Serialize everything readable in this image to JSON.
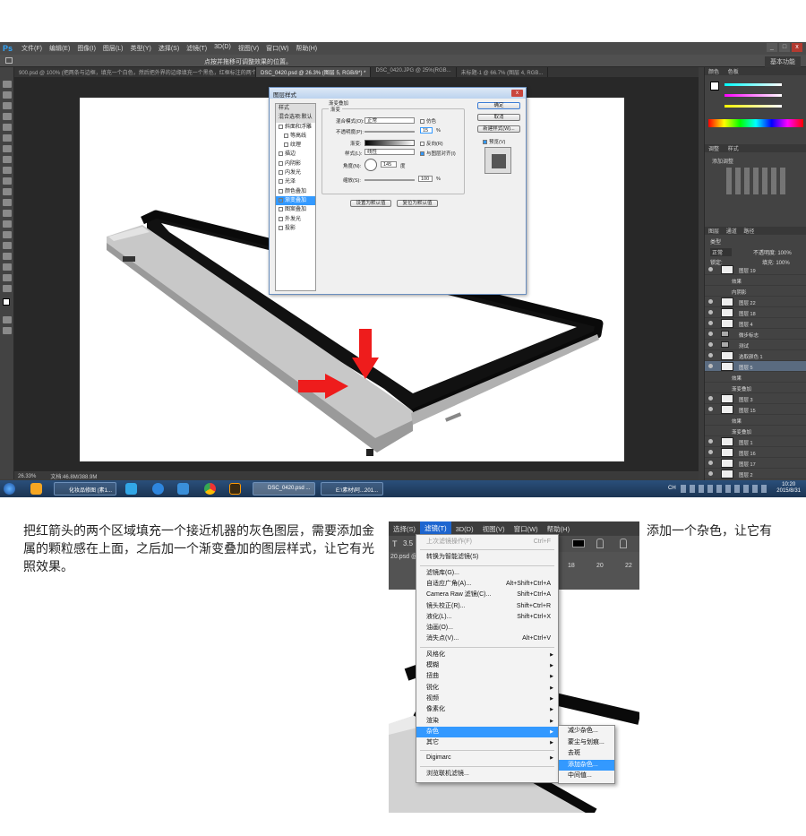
{
  "ps": {
    "logo": "Ps",
    "menu": [
      "文件(F)",
      "编辑(E)",
      "图像(I)",
      "图层(L)",
      "类型(Y)",
      "选择(S)",
      "滤镜(T)",
      "3D(D)",
      "视图(V)",
      "窗口(W)",
      "帮助(H)"
    ],
    "window_buttons": [
      "_",
      "□",
      "x"
    ],
    "options_hint": "点按并拖移可调整效果的位置。",
    "workspace": "基本功能",
    "tabs": [
      "900.psd @ 100% (把两条与边框，填充一个白色，然后把外界的边缘填充一个黑色，红框标注的两个地方需要在...",
      "DSC_0420.psd @ 26.3% (图层 5, RGB/8*) *",
      "DSC_0420.JPG @ 25%(RGB...",
      "未标题-1 @ 66.7% (图层 4, RGB..."
    ],
    "status": {
      "zoom": "26.33%",
      "doc": "文档:46.8M/388.9M"
    },
    "dialog": {
      "title": "图层样式",
      "close": "x",
      "styles_header": "样式",
      "blend_options": "混合选项:默认",
      "styles": [
        {
          "label": "斜面和浮雕",
          "checked": false
        },
        {
          "label": "等高线",
          "checked": false
        },
        {
          "label": "纹理",
          "checked": false
        },
        {
          "label": "描边",
          "checked": false
        },
        {
          "label": "内阴影",
          "checked": false
        },
        {
          "label": "内发光",
          "checked": false
        },
        {
          "label": "光泽",
          "checked": false
        },
        {
          "label": "颜色叠加",
          "checked": false
        },
        {
          "label": "渐变叠加",
          "checked": true
        },
        {
          "label": "图案叠加",
          "checked": false
        },
        {
          "label": "外发光",
          "checked": false
        },
        {
          "label": "投影",
          "checked": false
        }
      ],
      "section_title": "渐变叠加",
      "group_title": "渐变",
      "blend_mode_label": "混合模式(O):",
      "blend_mode_value": "正常",
      "dither_label": "仿色",
      "opacity_label": "不透明度(P):",
      "opacity_value": "15",
      "percent": "%",
      "gradient_label": "渐变:",
      "reverse_label": "反向(R)",
      "style_label": "样式(L):",
      "style_value": "线性",
      "align_label": "与图层对齐(I)",
      "angle_label": "角度(N):",
      "angle_value": "145",
      "degree": "度",
      "scale_label": "缩放(S):",
      "scale_value": "100",
      "btn_default": "设置为默认值",
      "btn_reset": "复位为默认值",
      "btn_ok": "确定",
      "btn_cancel": "取消",
      "btn_new_style": "新建样式(W)...",
      "preview_label": "预览(V)"
    },
    "right_panel": {
      "color_tabs": [
        "颜色",
        "色板"
      ],
      "adjust_tabs": [
        "调整",
        "样式"
      ],
      "adjust_add": "添加调整",
      "layer_tabs": [
        "图层",
        "通道",
        "路径"
      ],
      "filter_kind": "类型",
      "blend": "正常",
      "opacity": "不透明度: 100%",
      "lock": "锁定:",
      "fill": "填充: 100%",
      "layers": [
        {
          "name": "图层 19",
          "type": "layer",
          "selected": false
        },
        {
          "name": "效果",
          "type": "sub",
          "selected": false
        },
        {
          "name": "内阴影",
          "type": "sub",
          "selected": false
        },
        {
          "name": "图层 22",
          "type": "layer",
          "selected": false
        },
        {
          "name": "图层 18",
          "type": "layer",
          "selected": false
        },
        {
          "name": "图层 4",
          "type": "layer",
          "selected": false
        },
        {
          "name": "微步标志",
          "type": "group",
          "selected": false
        },
        {
          "name": "测试",
          "type": "group",
          "selected": false
        },
        {
          "name": "选取颜色 1",
          "type": "layer",
          "selected": false
        },
        {
          "name": "图层 5",
          "type": "layer",
          "selected": true
        },
        {
          "name": "效果",
          "type": "sub",
          "selected": false
        },
        {
          "name": "渐变叠加",
          "type": "sub",
          "selected": false
        },
        {
          "name": "图层 3",
          "type": "layer",
          "selected": false
        },
        {
          "name": "图层 15",
          "type": "layer",
          "selected": false
        },
        {
          "name": "效果",
          "type": "sub",
          "selected": false
        },
        {
          "name": "渐变叠加",
          "type": "sub",
          "selected": false
        },
        {
          "name": "图层 1",
          "type": "layer",
          "selected": false
        },
        {
          "name": "图层 16",
          "type": "layer",
          "selected": false
        },
        {
          "name": "图层 17",
          "type": "layer",
          "selected": false
        },
        {
          "name": "图层 2",
          "type": "layer",
          "selected": false
        },
        {
          "name": "镜头校正",
          "type": "layer",
          "selected": false
        },
        {
          "name": "背景",
          "type": "layer",
          "selected": false
        }
      ]
    },
    "taskbar": {
      "tasks": [
        "化妆品修图 (素1...",
        "DSC_0420.psd ...",
        "E:\\素材\\阿...201..."
      ],
      "tray_text": "CH",
      "time": "10:20",
      "date": "2015/8/31"
    }
  },
  "article": {
    "para1": "把红箭头的两个区域填充一个接近机器的灰色图层，需要添加金属的颗粒感在上面，之后加一个渐变叠加的图层样式，让它有光照效果。",
    "para2": "添加一个杂色，让它有"
  },
  "filter_menu": {
    "menubar": [
      "选择(S)",
      "滤镜(T)",
      "3D(D)",
      "视图(V)",
      "窗口(W)",
      "帮助(H)"
    ],
    "ruler": [
      "8",
      "10",
      "12",
      "14",
      "16",
      "18",
      "20",
      "22"
    ],
    "ruler_tab": "20.psd @",
    "tool_label": "3.5",
    "items": [
      {
        "label": "上次滤镜操作(F)",
        "shortcut": "Ctrl+F",
        "disabled": true
      },
      {
        "sep": true
      },
      {
        "label": "转换为智能滤镜(S)",
        "shortcut": ""
      },
      {
        "sep": true
      },
      {
        "label": "滤镜库(G)...",
        "shortcut": ""
      },
      {
        "label": "自适应广角(A)...",
        "shortcut": "Alt+Shift+Ctrl+A"
      },
      {
        "label": "Camera Raw 滤镜(C)...",
        "shortcut": "Shift+Ctrl+A"
      },
      {
        "label": "镜头校正(R)...",
        "shortcut": "Shift+Ctrl+R"
      },
      {
        "label": "液化(L)...",
        "shortcut": "Shift+Ctrl+X"
      },
      {
        "label": "油画(O)...",
        "shortcut": ""
      },
      {
        "label": "消失点(V)...",
        "shortcut": "Alt+Ctrl+V"
      },
      {
        "sep": true
      },
      {
        "label": "风格化",
        "sub": true
      },
      {
        "label": "模糊",
        "sub": true
      },
      {
        "label": "扭曲",
        "sub": true
      },
      {
        "label": "锐化",
        "sub": true
      },
      {
        "label": "视频",
        "sub": true
      },
      {
        "label": "像素化",
        "sub": true
      },
      {
        "label": "渲染",
        "sub": true
      },
      {
        "label": "杂色",
        "sub": true,
        "highlight": true
      },
      {
        "label": "其它",
        "sub": true
      },
      {
        "sep": true
      },
      {
        "label": "Digimarc",
        "sub": true
      },
      {
        "sep": true
      },
      {
        "label": "浏览联机滤镜...",
        "shortcut": ""
      }
    ],
    "submenu": [
      {
        "label": "减少杂色...",
        "highlight": false
      },
      {
        "label": "蒙尘与划痕...",
        "highlight": false
      },
      {
        "label": "去斑",
        "highlight": false
      },
      {
        "label": "添加杂色...",
        "highlight": true
      },
      {
        "label": "中间值...",
        "highlight": false
      }
    ]
  }
}
